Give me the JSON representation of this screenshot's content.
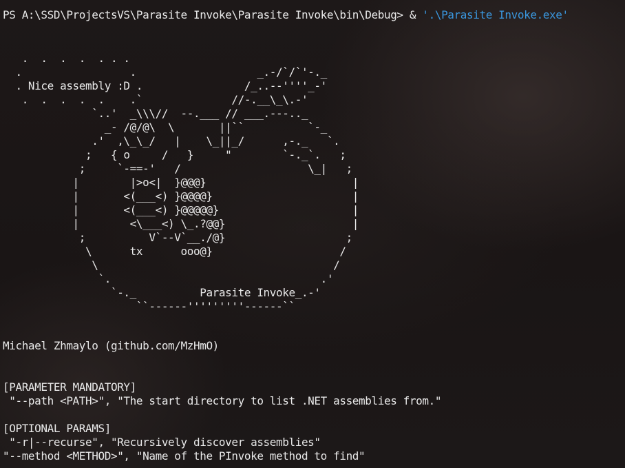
{
  "terminal": {
    "prompt": "PS A:\\SSD\\ProjectsVS\\Parasite Invoke\\Parasite Invoke\\bin\\Debug> ",
    "operator": "& ",
    "command": "'.\\Parasite Invoke.exe'"
  },
  "banner": {
    "ascii_art": "   .  .  .  .  . . .\n  .                 .                   _.-/`/`'-._\n  . Nice assembly :D .                /_..--''''_-'\n   .  .  .  .  .    .`              //-.__\\_\\.-'\n              `..'  _\\\\\\//  --.___ // ___.---.._\n                _- /@/@\\  \\       ||``          `-_\n              .'  ,\\_\\_/   |    \\_||_/      ,-._   `.\n             ;   { o     /   }     \"        `-._`.   ;\n            ;     `-==-'   /                    \\_|   ;\n           |        |>o<|  }@@@}                       |\n           |       <(___<) }@@@@}                      |\n           |       <(___<) }@@@@@}                     |\n           |        <\\___<) \\_.?@@}                    |\n            ;          V`--V`__./@}                   ;\n             \\      tx      ooo@}                    /\n              \\                                     /\n               `.                                 .'\n                 `-._          Parasite Invoke_.-'\n                     ``------'''''''''------``",
    "author": "Michael Zhmaylo (github.com/MzHmO)"
  },
  "help": {
    "mandatory_header": "[PARAMETER MANDATORY]",
    "mandatory_params": [
      " \"--path <PATH>\", \"The start directory to list .NET assemblies from.\""
    ],
    "optional_header": "[OPTIONAL PARAMS]",
    "optional_params": [
      " \"-r|--recurse\", \"Recursively discover assemblies\"",
      "\"--method <METHOD>\", \"Name of the PInvoke method to find\""
    ]
  }
}
